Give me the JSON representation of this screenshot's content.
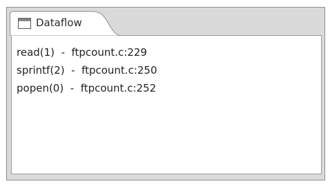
{
  "tab": {
    "label": "Dataflow",
    "icon": "view-window-icon"
  },
  "entries": [
    "read(1)  -  ftpcount.c:229",
    "sprintf(2)  -  ftpcount.c:250",
    "popen(0)  -  ftpcount.c:252"
  ],
  "colors": {
    "panel_background": "#dadada",
    "content_background": "#ffffff",
    "border": "#8e8e8e"
  }
}
